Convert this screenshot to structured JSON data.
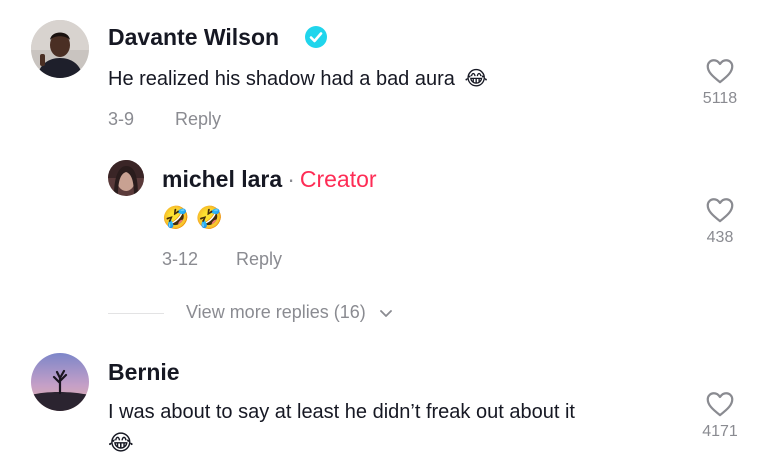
{
  "comments": [
    {
      "author": "Davante Wilson",
      "verified": true,
      "text": "He realized his shadow had a bad aura",
      "emoji": "😂",
      "date": "3-9",
      "reply_label": "Reply",
      "likes": "5118",
      "replies": [
        {
          "author": "michel lara",
          "separator": "·",
          "badge": "Creator",
          "emojis": [
            "🤣",
            "🤣"
          ],
          "date": "3-12",
          "reply_label": "Reply",
          "likes": "438"
        }
      ],
      "view_more": "View more replies (16)"
    },
    {
      "author": "Bernie",
      "text": "I was about to say at least he didn’t freak out about it",
      "emoji": "😂",
      "likes": "4171"
    }
  ],
  "icons": {
    "verified": "verified-badge-icon",
    "like": "heart-outline-icon",
    "expand": "chevron-down-icon"
  },
  "colors": {
    "creator_badge": "#fe2c55",
    "verified": "#20d5ec",
    "secondary_text": "#8a8b91"
  }
}
